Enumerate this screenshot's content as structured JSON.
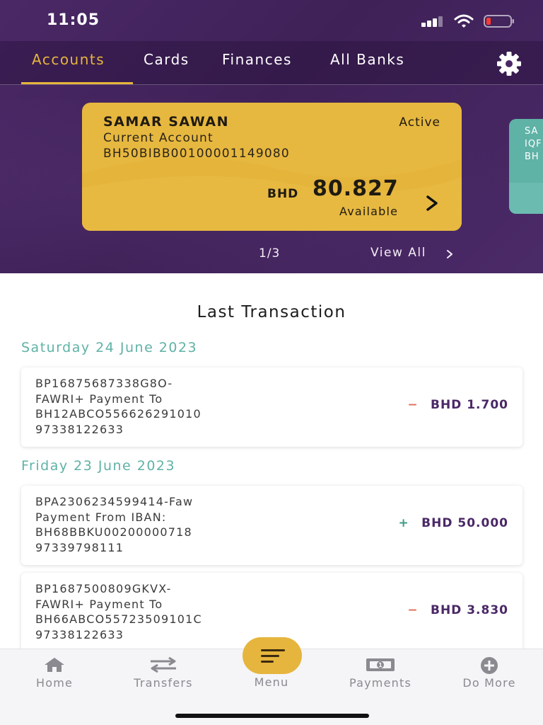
{
  "status_bar": {
    "time": "11:05"
  },
  "tabs": [
    {
      "label": "Accounts",
      "active": true
    },
    {
      "label": "Cards",
      "active": false
    },
    {
      "label": "Finances",
      "active": false
    },
    {
      "label": "All Banks",
      "active": false
    }
  ],
  "account_card": {
    "holder": "SAMAR SAWAN",
    "type": "Current Account",
    "iban": "BH50BIBB00100001149080",
    "status": "Active",
    "currency": "BHD",
    "amount": "80.827",
    "available_label": "Available"
  },
  "peek_card": {
    "lines": [
      "SA",
      "IQF",
      "BH"
    ]
  },
  "carousel": {
    "pager": "1/3",
    "view_all": "View All"
  },
  "transactions": {
    "title": "Last Transaction",
    "groups": [
      {
        "date": "Saturday 24 June 2023",
        "items": [
          {
            "lines": [
              "BP16875687338G8O-",
              "FAWRI+ Payment To",
              "BH12ABCO556626291010",
              "97338122633"
            ],
            "sign": "−",
            "amount": "BHD 1.700"
          }
        ]
      },
      {
        "date": "Friday 23 June 2023",
        "items": [
          {
            "lines": [
              "BPA2306234599414-Faw",
              "Payment From IBAN:",
              "BH68BBKU00200000718",
              "97339798111"
            ],
            "sign": "+",
            "amount": "BHD 50.000"
          },
          {
            "lines": [
              "BP1687500809GKVX-",
              "FAWRI+ Payment To",
              "BH66ABCO55723509101C",
              "97338122633"
            ],
            "sign": "−",
            "amount": "BHD 3.830"
          }
        ]
      }
    ]
  },
  "bottom_nav": {
    "home": "Home",
    "transfers": "Transfers",
    "menu": "Menu",
    "payments": "Payments",
    "do_more": "Do More"
  },
  "colors": {
    "brand_purple": "#4a2866",
    "accent_gold": "#e6b53d",
    "teal": "#5fb2a6",
    "negative": "#e0705a",
    "positive": "#3e9a86"
  }
}
